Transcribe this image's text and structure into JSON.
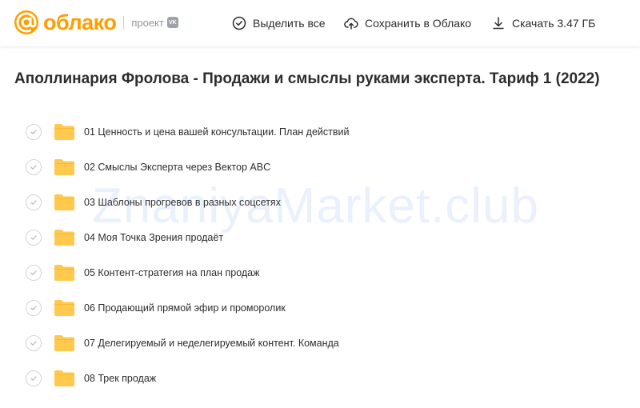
{
  "header": {
    "logo_text": "облако",
    "project_label": "проект",
    "vk_badge": "VK",
    "actions": [
      {
        "label": "Выделить все",
        "icon": "check-circle-icon"
      },
      {
        "label": "Сохранить в Облако",
        "icon": "cloud-upload-icon"
      },
      {
        "label": "Скачать 3.47 ГБ",
        "icon": "download-icon"
      }
    ]
  },
  "page": {
    "title": "Аполлинария Фролова - Продажи и смыслы руками эксперта. Тариф 1 (2022)"
  },
  "folders": [
    {
      "name": "01 Ценность и цена вашей консультации. План действий"
    },
    {
      "name": "02 Смыслы Эксперта через Вектор ABC"
    },
    {
      "name": "03 Шаблоны прогревов в разных соцсетях"
    },
    {
      "name": "04 Моя Точка Зрения продаёт"
    },
    {
      "name": "05 Контент-стратегия на план продаж"
    },
    {
      "name": "06 Продающий прямой эфир и проморолик"
    },
    {
      "name": "07 Делегируемый и неделегируемый контент. Команда"
    },
    {
      "name": "08 Трек продаж"
    }
  ],
  "watermark": "ZnaniyaMarket.club",
  "colors": {
    "brand": "#ff9e00",
    "folder": "#ffc94d",
    "text": "#2c2d2e"
  }
}
